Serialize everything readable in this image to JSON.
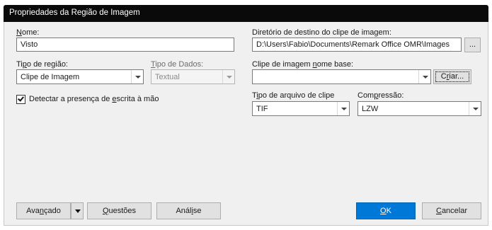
{
  "window": {
    "title": "Propriedades da Região de Imagem"
  },
  "fields": {
    "nome": {
      "label_prefix": "N",
      "label_rest": "ome:",
      "value": "Visto"
    },
    "tipo_regiao": {
      "label_prefix": "Ti",
      "label_u": "p",
      "label_rest": "o de região:",
      "value": "Clipe de Imagem"
    },
    "tipo_dados": {
      "label_u": "T",
      "label_rest": "ipo de Dados:",
      "value": "Textual"
    },
    "detectar": {
      "label_pre": "Detectar a presença de ",
      "label_u": "e",
      "label_rest": "scrita à mão",
      "checked": true
    },
    "diretorio": {
      "label": "Diretório de destino do clipe de imagem:",
      "value": "D:\\Users\\Fabio\\Documents\\Remark Office OMR\\Images",
      "browse_label": "..."
    },
    "clipe_nome": {
      "label_pre": "Clipe de imagem ",
      "label_u": "n",
      "label_rest": "ome base:",
      "value": "",
      "create_pre": "C",
      "create_u": "r",
      "create_rest": "iar..."
    },
    "tipo_arquivo": {
      "label_pre": "T",
      "label_u": "i",
      "label_rest": "po de arquivo de clipe",
      "value": "TIF"
    },
    "compressao": {
      "label_pre": "Com",
      "label_u": "p",
      "label_rest": "ressão:",
      "value": "LZW"
    }
  },
  "buttons": {
    "avancado": {
      "pre": "Ava",
      "u": "n",
      "rest": "çado"
    },
    "questoes": {
      "pre": "",
      "u": "Q",
      "rest": "uestões"
    },
    "analise": {
      "pre": "Anál",
      "u": "i",
      "rest": "se"
    },
    "ok": {
      "pre": "",
      "u": "O",
      "rest": "K"
    },
    "cancelar": {
      "pre": "",
      "u": "C",
      "rest": "ancelar"
    }
  },
  "colors": {
    "titlebar": "#0a0a0a",
    "primary": "#0078d7",
    "dialog_bg": "#f0f0f0"
  }
}
